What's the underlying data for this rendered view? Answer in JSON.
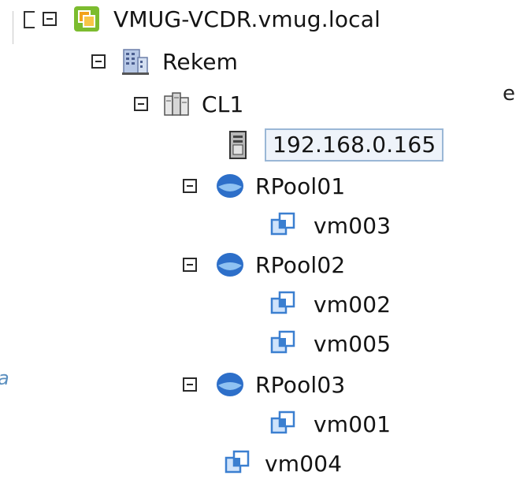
{
  "tree": {
    "root": {
      "label": "VMUG-VCDR.vmug.local",
      "icon": "vcenter-icon",
      "state": "expanded"
    },
    "datacenter": {
      "label": "Rekem",
      "icon": "datacenter-icon",
      "state": "expanded"
    },
    "cluster": {
      "label": "CL1",
      "icon": "cluster-icon",
      "state": "expanded"
    },
    "host": {
      "label": "192.168.0.165",
      "icon": "host-icon",
      "selected": true
    },
    "pools": [
      {
        "label": "RPool01",
        "icon": "resource-pool-icon",
        "state": "expanded",
        "vms": [
          {
            "label": "vm003",
            "icon": "vm-icon"
          }
        ]
      },
      {
        "label": "RPool02",
        "icon": "resource-pool-icon",
        "state": "expanded",
        "vms": [
          {
            "label": "vm002",
            "icon": "vm-icon"
          },
          {
            "label": "vm005",
            "icon": "vm-icon"
          }
        ]
      },
      {
        "label": "RPool03",
        "icon": "resource-pool-icon",
        "state": "expanded",
        "vms": [
          {
            "label": "vm001",
            "icon": "vm-icon"
          }
        ]
      }
    ],
    "standalone_vm": {
      "label": "vm004",
      "icon": "vm-icon"
    }
  },
  "edge_text": {
    "right": "e",
    "left": "a"
  },
  "colors": {
    "selection_border": "#9ab7d6",
    "selection_fill": "#eef3fa",
    "vm_icon": "#3b7fd0",
    "pool_icon": "#2d6fc9",
    "vcenter_icon_green": "#7cbc2f",
    "vcenter_icon_orange": "#f2a21a"
  }
}
